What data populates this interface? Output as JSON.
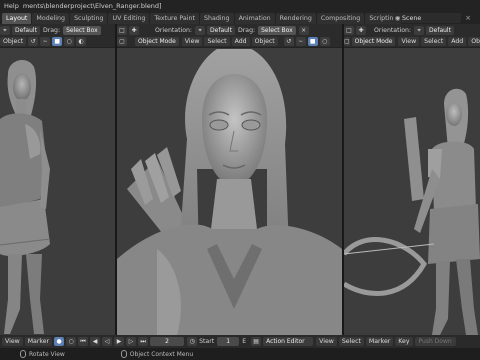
{
  "topbar": {
    "help_menu": "Help",
    "file_path": "ments\\blenderproject\\Elven_Ranger.blend]"
  },
  "workspace_tabs": [
    {
      "label": "Layout",
      "active": true
    },
    {
      "label": "Modeling",
      "active": false
    },
    {
      "label": "Sculpting",
      "active": false
    },
    {
      "label": "UV Editing",
      "active": false
    },
    {
      "label": "Texture Paint",
      "active": false
    },
    {
      "label": "Shading",
      "active": false
    },
    {
      "label": "Animation",
      "active": false
    },
    {
      "label": "Rendering",
      "active": false
    },
    {
      "label": "Compositing",
      "active": false
    },
    {
      "label": "Scripting",
      "active": false
    }
  ],
  "workspace_add": "+",
  "scene_selector": {
    "value": "Scene"
  },
  "viewports": [
    {
      "orientation_value": "Default",
      "drag_label": "Drag:",
      "drag_value": "Select Box",
      "object_label": "Object",
      "menus": []
    },
    {
      "orientation_label": "Orientation:",
      "orientation_value": "Default",
      "drag_label": "Drag:",
      "drag_value": "Select Box",
      "mode": "Object Mode",
      "menus": [
        "View",
        "Select",
        "Add",
        "Object"
      ]
    },
    {
      "orientation_label": "Orientation:",
      "orientation_value": "Default",
      "mode": "Object Mode",
      "menus": [
        "View",
        "Select",
        "Add",
        "Object"
      ]
    }
  ],
  "timeline": {
    "view_label": "View",
    "marker_label": "Marker",
    "current_frame": "2",
    "start_label": "Start",
    "start_value": "1",
    "end_label": "E"
  },
  "action_editor": {
    "mode": "Action Editor",
    "menus": [
      "View",
      "Select",
      "Marker",
      "Key"
    ],
    "push_down": "Push Down"
  },
  "status": {
    "left_action": "Rotate View",
    "right_action": "Object Context Menu"
  }
}
